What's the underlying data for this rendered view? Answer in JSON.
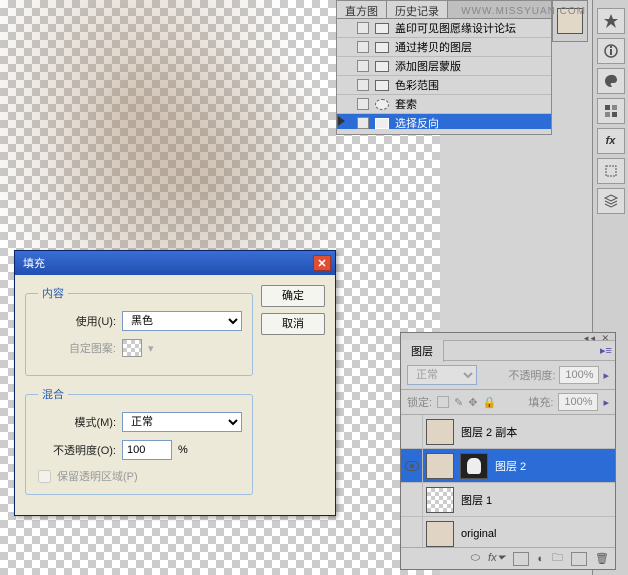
{
  "watermark": "WWW.MISSYUAN.COM",
  "history": {
    "tabs": [
      "直方图",
      "历史记录"
    ],
    "items": [
      "盖印可见图愿缘设计论坛",
      "通过拷贝的图层",
      "添加图层蒙版",
      "色彩范围",
      "套索",
      "选择反向"
    ],
    "selected_index": 5
  },
  "toolbar_icons": [
    "arrows-icon",
    "info-icon",
    "palette-icon",
    "swatches-icon",
    "fx-icon",
    "crop-icon",
    "layers-icon"
  ],
  "dialog": {
    "title": "填充",
    "ok": "确定",
    "cancel": "取消",
    "group_content": "内容",
    "use_label": "使用(U):",
    "use_value": "黑色",
    "pattern_label": "自定图案:",
    "group_blend": "混合",
    "mode_label": "模式(M):",
    "mode_value": "正常",
    "opacity_label": "不透明度(O):",
    "opacity_value": "100",
    "opacity_unit": "%",
    "preserve_label": "保留透明区域(P)"
  },
  "layers": {
    "tab": "图层",
    "blend_mode": "正常",
    "opacity_label": "不透明度:",
    "opacity_value": "100%",
    "lock_label": "锁定:",
    "fill_label": "填充:",
    "fill_value": "100%",
    "items": [
      {
        "name": "图层 2 副本",
        "visible": false,
        "mask": false,
        "thumb": "photo"
      },
      {
        "name": "图层 2",
        "visible": true,
        "mask": true,
        "thumb": "photo",
        "selected": true
      },
      {
        "name": "图层 1",
        "visible": false,
        "mask": false,
        "thumb": "checker"
      },
      {
        "name": "original",
        "visible": false,
        "mask": false,
        "thumb": "photo"
      }
    ],
    "footer_icons": [
      "link-icon",
      "fx-icon",
      "mask-icon",
      "adjust-icon",
      "folder-icon",
      "new-icon",
      "trash-icon"
    ]
  }
}
